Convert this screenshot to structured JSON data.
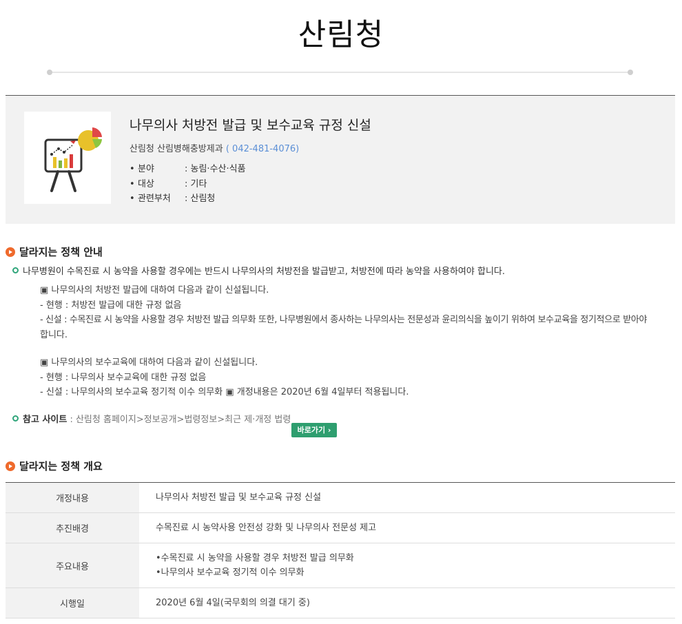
{
  "page_title": "산림청",
  "policy": {
    "title": "나무의사 처방전 발급 및 보수교육 규정 신설",
    "department": "산림청 산림병해충방제과",
    "phone": "( 042-481-4076)",
    "meta": [
      {
        "key": "분야",
        "value": ": 농림·수산·식품"
      },
      {
        "key": "대상",
        "value": ": 기타"
      },
      {
        "key": "관련부처",
        "value": ": 산림청"
      }
    ]
  },
  "guide": {
    "heading": "달라지는 정책 안내",
    "summary": "나무병원이 수목진료 시 농약을 사용할 경우에는 반드시 나무의사의 처방전을 발급받고, 처방전에 따라 농약을 사용하여야 합니다.",
    "block1": {
      "line1": "▣ 나무의사의 처방전 발급에 대하여 다음과 같이 신설됩니다.",
      "line2": "- 현행 : 처방전 발급에 대한 규정 없음",
      "line3a": "- 신설 : 수목진료 시 농약을 사용할 경우 처방전 발급 의무화 또한, 나무병원에서 종사하는 나무의사는 전문성과 윤리의식을 높이기 위하여 보수교육을 정기적으로 받아야",
      "line3b": "합니다."
    },
    "block2": {
      "line1": "▣ 나무의사의 보수교육에 대하여 다음과 같이 신설됩니다.",
      "line2": "- 현행 : 나무의사 보수교육에 대한 규정 없음",
      "line3": "- 신설 : 나무의사의 보수교육 정기적 이수 의무화 ▣ 개정내용은 2020년 6월 4일부터 적용됩니다."
    },
    "ref_label": "참고 사이트",
    "ref_text": " : 산림청 홈페이지>정보공개>법령정보>최근 제·개정 법령",
    "go_button": "바로가기 ›"
  },
  "overview": {
    "heading": "달라지는 정책 개요",
    "rows": [
      {
        "label": "개정내용",
        "lines": [
          "나무의사 처방전 발급 및 보수교육 규정 신설"
        ]
      },
      {
        "label": "추진배경",
        "lines": [
          "수목진료 시 농약사용 안전성 강화 및 나무의사 전문성 제고"
        ]
      },
      {
        "label": "주요내용",
        "lines": [
          "•수목진료 시 농약을 사용할 경우 처방전 발급 의무화",
          "•나무의사 보수교육 정기적 이수 의무화"
        ]
      },
      {
        "label": "시행일",
        "lines": [
          "2020년 6월 4일(국무회의 의결 대기 중)"
        ]
      }
    ]
  },
  "colors": {
    "accent_orange": "#ef6a2c",
    "accent_green": "#2e9e6f",
    "phone_blue": "#5b8fd6"
  },
  "icons": [
    "presentation-chart-icon",
    "arrow-circle-icon",
    "green-circle-bullet-icon"
  ]
}
